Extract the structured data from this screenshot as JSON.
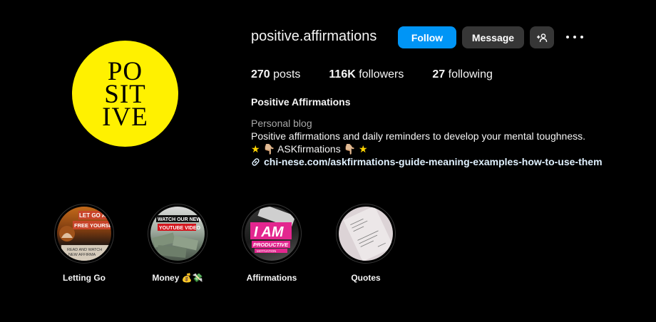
{
  "profile": {
    "username": "positive.affirmations",
    "avatar_text": [
      "PO",
      "SIT",
      "IVE"
    ],
    "follow_label": "Follow",
    "message_label": "Message",
    "add_user_icon": "add-user-icon",
    "more_icon": "more-options-icon",
    "colors": {
      "background": "#000000",
      "follow": "#0095f6",
      "secondary_button": "#363636",
      "avatar": "#fff100"
    }
  },
  "stats": {
    "posts_count": "270",
    "posts_label": "posts",
    "followers_count": "116K",
    "followers_label": "followers",
    "following_count": "27",
    "following_label": "following"
  },
  "bio": {
    "full_name": "Positive Affirmations",
    "category": "Personal blog",
    "line1": "Positive affirmations and daily reminders to develop your mental toughness.",
    "line2_star": "★",
    "line2_hand_left": "👇🏼",
    "line2_text": "ASKfirmations",
    "line2_hand_right": "👇🏼",
    "link_icon": "link-icon",
    "link_text": "chi-nese.com/askfirmations-guide-meaning-examples-how-to-use-them"
  },
  "highlights": [
    {
      "label": "Letting Go",
      "cover_text": [
        "LET GO AN",
        "FREE YOURSELF",
        "READ AND WATCH",
        "NEW AFFIRMA"
      ]
    },
    {
      "label": "Money 💰💸",
      "cover_text": [
        "WATCH OUR NEW",
        "YOUTUBE VIDEO"
      ]
    },
    {
      "label": "Affirmations",
      "cover_text": [
        "I AM",
        "PRODUCTIVE",
        "MOTIVATION"
      ]
    },
    {
      "label": "Quotes",
      "cover_text": []
    }
  ]
}
